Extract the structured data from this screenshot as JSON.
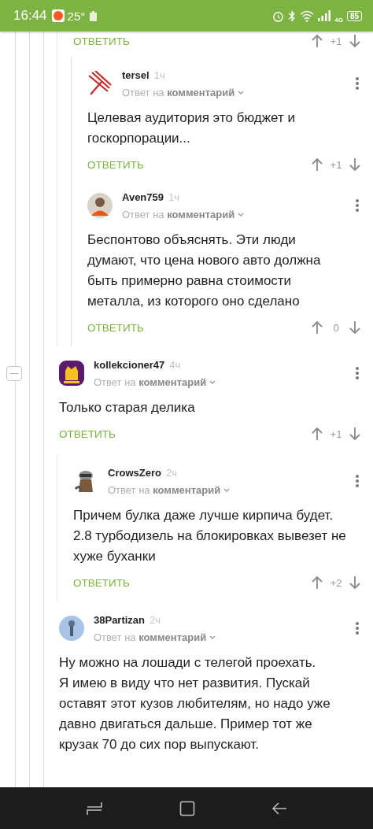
{
  "status_bar": {
    "time": "16:44",
    "temperature": "25°",
    "network": "4G",
    "battery": "85"
  },
  "comments": [
    {
      "children": [
        {
          "reply": "ОТВЕТИТЬ",
          "score": "+1",
          "children": [
            {
              "author": "tersel",
              "time": "1ч",
              "context": "Ответ на **комментарий**",
              "text": "Целевая аудитория это бюджет и госкорпорации...",
              "reply": "ОТВЕТИТЬ",
              "score": "+1"
            },
            {
              "author": "Aven759",
              "time": "1ч",
              "context": "Ответ на **комментарий**",
              "text": "Беспонтово объяснять. Эти люди думают, что цена нового авто должна быть примерно равна стоимости металла, из которого оно сделано",
              "reply": "ОТВЕТИТЬ",
              "score": "0"
            }
          ]
        }
      ]
    },
    {
      "author": "kollekcioner47",
      "time": "4ч",
      "context": "Ответ на **комментарий**",
      "expanded": true,
      "text": "Только старая делика",
      "reply": "ОТВЕТИТЬ",
      "score": "+1",
      "children": [
        {
          "author": "CrowsZero",
          "time": "2ч",
          "context": "Ответ на **комментарий**",
          "text": "Причем булка даже лучше кирпича будет. 2.8 турбодизель на блокировках вывезет не хуже буханки",
          "reply": "ОТВЕТИТЬ",
          "score": "+2"
        }
      ]
    },
    {
      "author": "38Partizan",
      "time": "2ч",
      "context": "Ответ на **комментарий**",
      "text": "Ну можно на лошади с телегой проехать.\nЯ имею в виду что нет развития. Пускай оставят этот кузов любителям, но надо уже давно двигаться дальше. Пример тот же крузак 70 до сих пор выпускают."
    }
  ]
}
